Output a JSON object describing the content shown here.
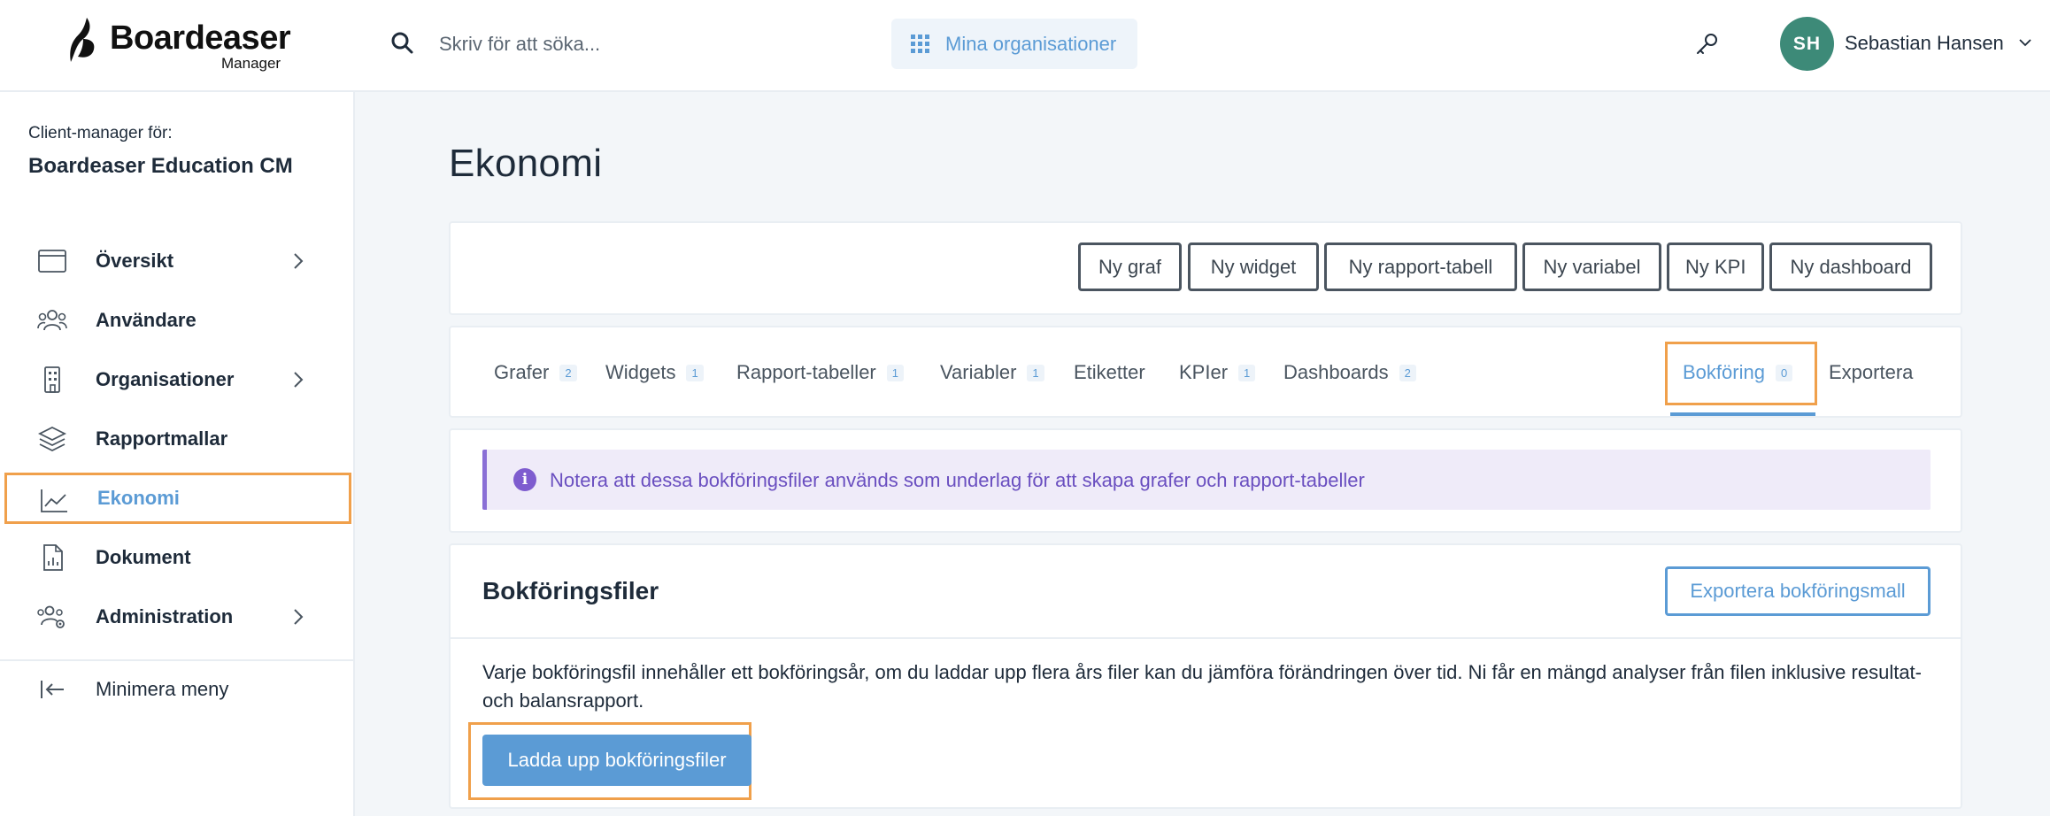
{
  "brand": {
    "name": "Boardeaser",
    "sub": "Manager"
  },
  "search": {
    "placeholder": "Skriv för att söka..."
  },
  "header": {
    "orgs_label": "Mina organisationer"
  },
  "user": {
    "initials": "SH",
    "name": "Sebastian Hansen"
  },
  "sidebar": {
    "client_label": "Client-manager för:",
    "client_name": "Boardeaser Education CM",
    "items": [
      {
        "label": "Översikt",
        "icon": "browser-window-icon"
      },
      {
        "label": "Användare",
        "icon": "users-icon"
      },
      {
        "label": "Organisationer",
        "icon": "building-icon"
      },
      {
        "label": "Rapportmallar",
        "icon": "layers-icon"
      },
      {
        "label": "Ekonomi",
        "icon": "line-chart-icon"
      },
      {
        "label": "Dokument",
        "icon": "document-icon"
      },
      {
        "label": "Administration",
        "icon": "users-gear-icon"
      }
    ],
    "minimize_label": "Minimera meny"
  },
  "main": {
    "title": "Ekonomi",
    "actions": [
      "Ny graf",
      "Ny widget",
      "Ny rapport-tabell",
      "Ny variabel",
      "Ny KPI",
      "Ny dashboard"
    ],
    "tabs": [
      {
        "label": "Grafer",
        "count": "2"
      },
      {
        "label": "Widgets",
        "count": "1"
      },
      {
        "label": "Rapport-tabeller",
        "count": "1"
      },
      {
        "label": "Variabler",
        "count": "1"
      },
      {
        "label": "Etiketter"
      },
      {
        "label": "KPIer",
        "count": "1"
      },
      {
        "label": "Dashboards",
        "count": "2"
      },
      {
        "label": "Bokföring",
        "count": "0"
      },
      {
        "label": "Exportera"
      }
    ],
    "notice": "Notera att dessa bokföringsfiler används som underlag för att skapa grafer och rapport-tabeller",
    "files": {
      "title": "Bokföringsfiler",
      "export_label": "Exportera bokföringsmall",
      "description": "Varje bokföringsfil innehåller ett bokföringsår, om du laddar upp flera års filer kan du jämföra förändringen över tid. Ni får en mängd analyser från filen inklusive resultat- och balansrapport.",
      "upload_label": "Ladda upp bokföringsfiler"
    }
  },
  "colors": {
    "accent": "#5b9bd5",
    "highlight": "#f0a04b",
    "avatar": "#3d8a78",
    "notice": "#8a6fd6"
  }
}
